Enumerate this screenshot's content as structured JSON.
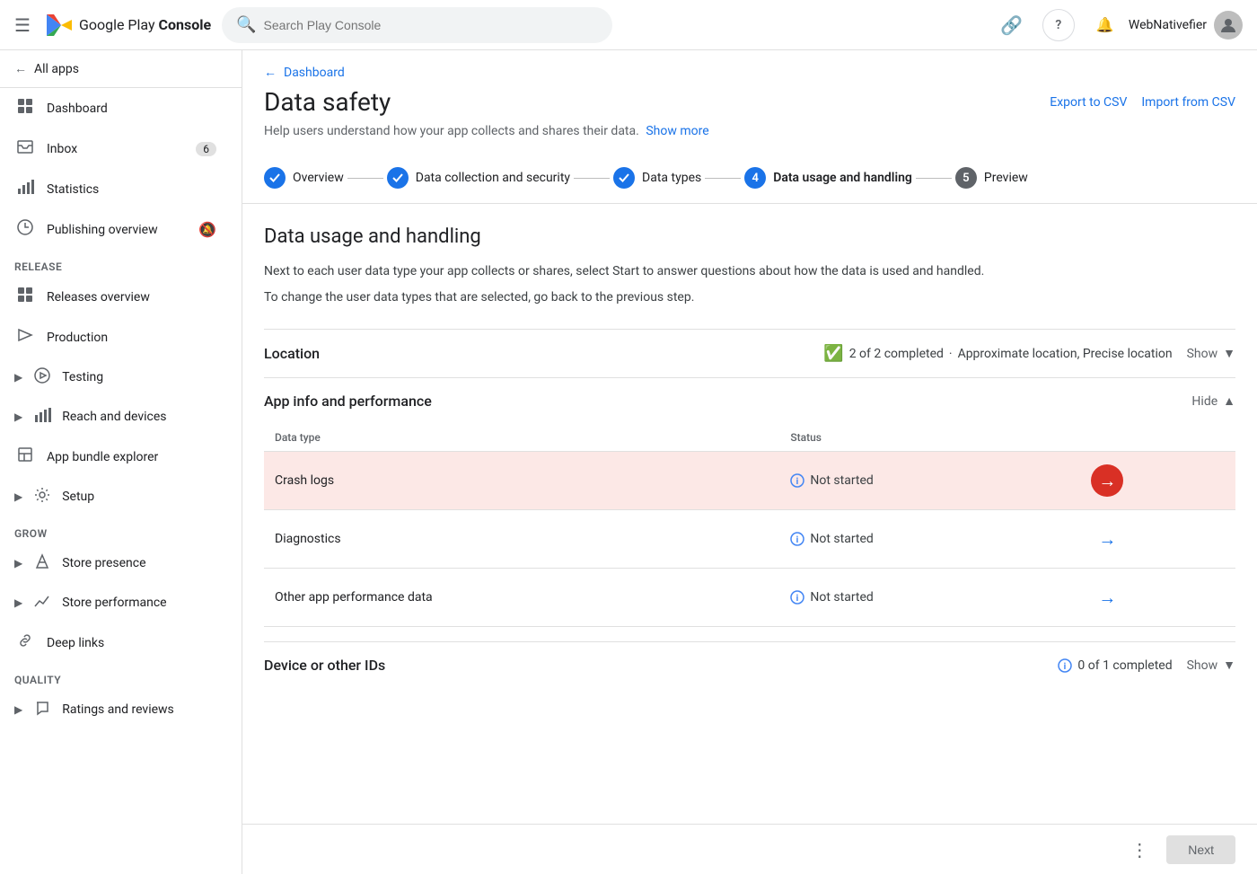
{
  "topbar": {
    "hamburger_label": "☰",
    "logo_text_pre": "Google Play ",
    "logo_text_post": "Console",
    "search_placeholder": "Search Play Console",
    "link_icon": "🔗",
    "help_icon": "?",
    "notification_icon": "🔔",
    "user_name": "WebNativefier",
    "avatar_text": "👤"
  },
  "sidebar": {
    "all_apps_label": "All apps",
    "nav_items": [
      {
        "id": "dashboard",
        "label": "Dashboard",
        "icon": "⊞"
      },
      {
        "id": "inbox",
        "label": "Inbox",
        "icon": "☐",
        "badge": "6"
      },
      {
        "id": "statistics",
        "label": "Statistics",
        "icon": "📊"
      },
      {
        "id": "publishing-overview",
        "label": "Publishing overview",
        "icon": "🕐",
        "mute": true
      }
    ],
    "release_section": "Release",
    "release_items": [
      {
        "id": "releases-overview",
        "label": "Releases overview",
        "icon": "⊞"
      },
      {
        "id": "production",
        "label": "Production",
        "icon": "🚀"
      },
      {
        "id": "testing",
        "label": "Testing",
        "icon": "▶",
        "expandable": true
      },
      {
        "id": "reach-and-devices",
        "label": "Reach and devices",
        "icon": "📊",
        "expandable": true
      },
      {
        "id": "app-bundle-explorer",
        "label": "App bundle explorer",
        "icon": "📦"
      },
      {
        "id": "setup",
        "label": "Setup",
        "icon": "⚙",
        "expandable": true
      }
    ],
    "grow_section": "Grow",
    "grow_items": [
      {
        "id": "store-presence",
        "label": "Store presence",
        "icon": "▷",
        "expandable": true
      },
      {
        "id": "store-performance",
        "label": "Store performance",
        "icon": "📈",
        "expandable": true
      },
      {
        "id": "deep-links",
        "label": "Deep links",
        "icon": "🔗"
      }
    ],
    "quality_section": "Quality",
    "quality_items": [
      {
        "id": "ratings-reviews",
        "label": "Ratings and reviews",
        "icon": "💬",
        "expandable": true
      }
    ]
  },
  "breadcrumb": {
    "arrow": "←",
    "label": "Dashboard"
  },
  "page": {
    "title": "Data safety",
    "subtitle": "Help users understand how your app collects and shares their data.",
    "show_more": "Show more",
    "export_csv": "Export to CSV",
    "import_csv": "Import from CSV"
  },
  "steps": [
    {
      "id": "overview",
      "label": "Overview",
      "state": "done",
      "number": "✓"
    },
    {
      "id": "data-collection",
      "label": "Data collection and security",
      "state": "done",
      "number": "✓"
    },
    {
      "id": "data-types",
      "label": "Data types",
      "state": "done",
      "number": "✓"
    },
    {
      "id": "data-usage",
      "label": "Data usage and handling",
      "state": "current",
      "number": "4"
    },
    {
      "id": "preview",
      "label": "Preview",
      "state": "upcoming",
      "number": "5"
    }
  ],
  "content": {
    "section_title": "Data usage and handling",
    "desc1": "Next to each user data type your app collects or shares, select Start to answer questions about how the data is used and handled.",
    "desc2": "To change the user data types that are selected, go back to the previous step."
  },
  "accordions": [
    {
      "id": "location",
      "title": "Location",
      "toggle_label": "Show",
      "toggle_icon": "▼",
      "status_icon": "check_circle",
      "status_text": "2 of 2 completed",
      "status_detail": "Approximate location, Precise location",
      "expanded": false,
      "rows": []
    },
    {
      "id": "app-info-performance",
      "title": "App info and performance",
      "toggle_label": "Hide",
      "toggle_icon": "▲",
      "expanded": true,
      "rows": [
        {
          "id": "crash-logs",
          "data_type": "Crash logs",
          "status": "Not started",
          "highlighted": true
        },
        {
          "id": "diagnostics",
          "data_type": "Diagnostics",
          "status": "Not started",
          "highlighted": false
        },
        {
          "id": "other-app-performance",
          "data_type": "Other app performance data",
          "status": "Not started",
          "highlighted": false
        }
      ]
    },
    {
      "id": "device-or-other-ids",
      "title": "Device or other IDs",
      "toggle_label": "Show",
      "toggle_icon": "▼",
      "status_icon": "info",
      "status_text": "0 of 1 completed",
      "expanded": false,
      "rows": []
    }
  ],
  "table_headers": {
    "data_type": "Data type",
    "status": "Status"
  },
  "bottom_bar": {
    "more_label": "⋮",
    "next_label": "Next"
  }
}
